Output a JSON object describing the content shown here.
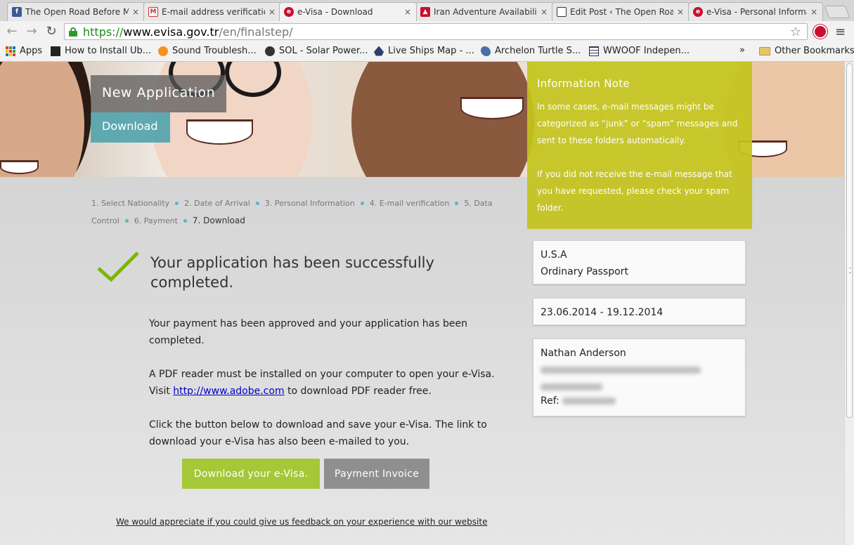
{
  "browser": {
    "tabs": [
      {
        "title": "The Open Road Before Me",
        "icon": "facebook-icon"
      },
      {
        "title": "E-mail address verification",
        "icon": "gmail-icon"
      },
      {
        "title": "e-Visa - Download",
        "icon": "evisa-icon",
        "active": true
      },
      {
        "title": "Iran Adventure Availability",
        "icon": "iran-icon"
      },
      {
        "title": "Edit Post ‹ The Open Road",
        "icon": "wordpress-icon"
      },
      {
        "title": "e-Visa - Personal Information",
        "icon": "evisa-icon"
      }
    ],
    "close_glyph": "×",
    "url": {
      "scheme": "https://",
      "host": "www.evisa.gov.tr",
      "path": "/en/finalstep/"
    },
    "bookmarks": [
      {
        "label": "Apps",
        "icon": "apps-grid-icon"
      },
      {
        "label": "How to Install Ub...",
        "icon": "htg-icon"
      },
      {
        "label": "Sound Troublesh...",
        "icon": "orange-gear-icon"
      },
      {
        "label": "SOL - Solar Power...",
        "icon": "sol-icon"
      },
      {
        "label": "Live Ships Map - ...",
        "icon": "ship-icon"
      },
      {
        "label": "Archelon Turtle S...",
        "icon": "turtle-icon"
      },
      {
        "label": "WWOOF Indepen...",
        "icon": "grid-icon"
      }
    ],
    "overflow": "»",
    "other_bookmarks": "Other Bookmarks"
  },
  "hero": {
    "new_application": "New Application",
    "download_tab": "Download"
  },
  "info_note": {
    "title": "Information Note",
    "para1": "In some cases, e-mail messages might be categorized as “junk” or “spam” messages and sent to these folders automatically.",
    "para2": "If you did not receive the e-mail message that you have requested, please check your spam folder."
  },
  "steps": [
    {
      "label": "1. Select Nationality"
    },
    {
      "label": "2. Date of Arrival"
    },
    {
      "label": "3. Personal Information"
    },
    {
      "label": "4. E-mail verification"
    },
    {
      "label": "5. Data Control"
    },
    {
      "label": "6. Payment"
    },
    {
      "label": "7. Download",
      "current": true
    }
  ],
  "main": {
    "success_title": "Your application has been successfully completed.",
    "payment_text": "Your payment has been approved and your application has been completed.",
    "pdf_text_before": "A PDF reader must be installed on your computer to open your e-Visa. Visit ",
    "pdf_link": "http://www.adobe.com",
    "pdf_text_after": " to download PDF reader free.",
    "download_text": "Click the button below to download and save your e-Visa. The link to download your e-Visa has also been e-mailed to you.",
    "download_button": "Download your e-Visa.",
    "invoice_button": "Payment Invoice",
    "feedback_link": "We would appreciate if you could give us feedback on your experience with our website"
  },
  "sidebar": {
    "country": "U.S.A",
    "passport_type": "Ordinary Passport",
    "validity": "23.06.2014 - 19.12.2014",
    "name": "Nathan Anderson",
    "ref_label": "Ref:"
  },
  "colors": {
    "info_note_bg": "#c4c41e",
    "download_button": "#a4c837",
    "invoice_button": "#8f8f8f",
    "download_tab": "#46a0aa",
    "check": "#7ab800"
  }
}
